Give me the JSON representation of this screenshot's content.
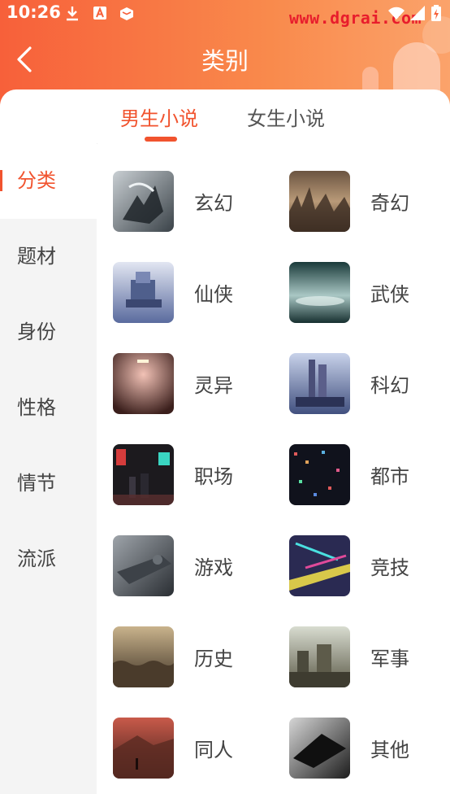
{
  "status_bar": {
    "time": "10:26",
    "watermark": "www.dgrai.com"
  },
  "header": {
    "title": "类别"
  },
  "tabs": [
    {
      "label": "男生小说",
      "active": true
    },
    {
      "label": "女生小说",
      "active": false
    }
  ],
  "sidebar": {
    "items": [
      {
        "label": "分类",
        "active": true
      },
      {
        "label": "题材"
      },
      {
        "label": "身份"
      },
      {
        "label": "性格"
      },
      {
        "label": "情节"
      },
      {
        "label": "流派"
      }
    ]
  },
  "categories": [
    {
      "label": "玄幻",
      "thumb": "fantasy-creature"
    },
    {
      "label": "奇幻",
      "thumb": "ruined-city"
    },
    {
      "label": "仙侠",
      "thumb": "floating-palace"
    },
    {
      "label": "武侠",
      "thumb": "misty-lake"
    },
    {
      "label": "灵异",
      "thumb": "dark-corridor"
    },
    {
      "label": "科幻",
      "thumb": "sci-fi-towers"
    },
    {
      "label": "职场",
      "thumb": "neon-street"
    },
    {
      "label": "都市",
      "thumb": "night-city"
    },
    {
      "label": "游戏",
      "thumb": "spaceship"
    },
    {
      "label": "竞技",
      "thumb": "racing-track"
    },
    {
      "label": "历史",
      "thumb": "army-crowd"
    },
    {
      "label": "军事",
      "thumb": "war-scene"
    },
    {
      "label": "同人",
      "thumb": "red-landscape"
    },
    {
      "label": "其他",
      "thumb": "monochrome-ship"
    }
  ],
  "colors": {
    "accent": "#f1532e",
    "header_start": "#f7603a",
    "header_end": "#fba36b"
  }
}
